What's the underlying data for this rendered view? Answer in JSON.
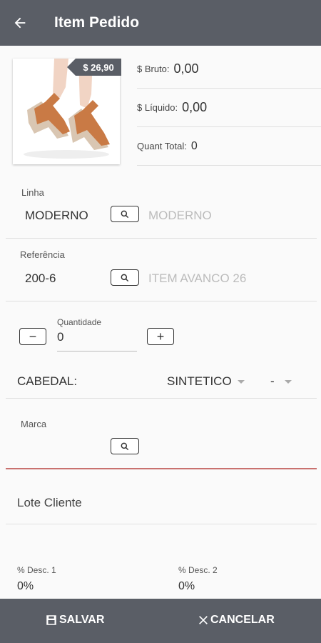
{
  "header": {
    "title": "Item Pedido",
    "back_icon": "arrow-left-icon"
  },
  "product": {
    "price_tag": "$ 26,90"
  },
  "summary": {
    "bruto_label": "$ Bruto:",
    "bruto_value": "0,00",
    "liquido_label": "$ Líquido:",
    "liquido_value": "0,00",
    "quant_label": "Quant Total:",
    "quant_value": "0"
  },
  "linha": {
    "label": "Linha",
    "value": "MODERNO",
    "description": "MODERNO"
  },
  "referencia": {
    "label": "Referência",
    "value": "200-6",
    "description": "ITEM AVANCO 26"
  },
  "quantidade": {
    "label": "Quantidade",
    "value": "0",
    "minus": "−",
    "plus": "+"
  },
  "cabedal": {
    "label": "CABEDAL:",
    "material": "SINTETICO",
    "color": "-"
  },
  "marca": {
    "label": "Marca",
    "value": ""
  },
  "lote": {
    "placeholder": "Lote Cliente"
  },
  "descontos": {
    "desc1_label": "% Desc. 1",
    "desc1_value": "0%",
    "desc2_label": "% Desc. 2",
    "desc2_value": "0%"
  },
  "footer": {
    "save_label": "SALVAR",
    "cancel_label": "CANCELAR"
  },
  "colors": {
    "bar": "#5a5e66",
    "error_line": "#c9716f"
  }
}
